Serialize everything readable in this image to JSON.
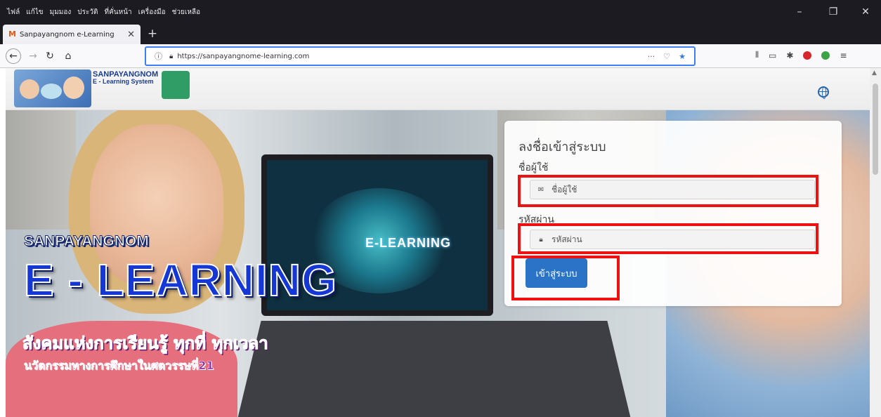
{
  "browser": {
    "menu": [
      "ไฟล์",
      "แก้ไข",
      "มุมมอง",
      "ประวัติ",
      "ที่คั่นหน้า",
      "เครื่องมือ",
      "ช่วยเหลือ"
    ],
    "tab_title": "Sanpayangnom e-Learning",
    "url": "https://sanpayangnome-learning.com",
    "icons": {
      "back": "back-arrow-icon",
      "forward": "forward-arrow-icon",
      "reload": "reload-icon",
      "home": "home-icon"
    }
  },
  "site": {
    "logo_line1": "SANPAYANGNOM",
    "logo_line2": "E - Learning System"
  },
  "hero": {
    "brand_top": "SANPAYANGNOM",
    "brand_main": "E - LEARNING",
    "screen_text": "E-LEARNING",
    "slogan1": "สังคมแห่งการเรียนรู้ ทุกที่ ทุกเวลา",
    "slogan2": "นวัตกรรมทางการศึกษาในศตวรรษที่21"
  },
  "login": {
    "title": "ลงชื่อเข้าสู่ระบบ",
    "username_label": "ชื่อผู้ใช้",
    "username_placeholder": "ชื่อผู้ใช้",
    "password_label": "รหัสผ่าน",
    "password_placeholder": "รหัสผ่าน",
    "submit_label": "เข้าสู่ระบบ"
  },
  "colors": {
    "accent": "#2b73c6",
    "highlight": "#ee1111"
  }
}
